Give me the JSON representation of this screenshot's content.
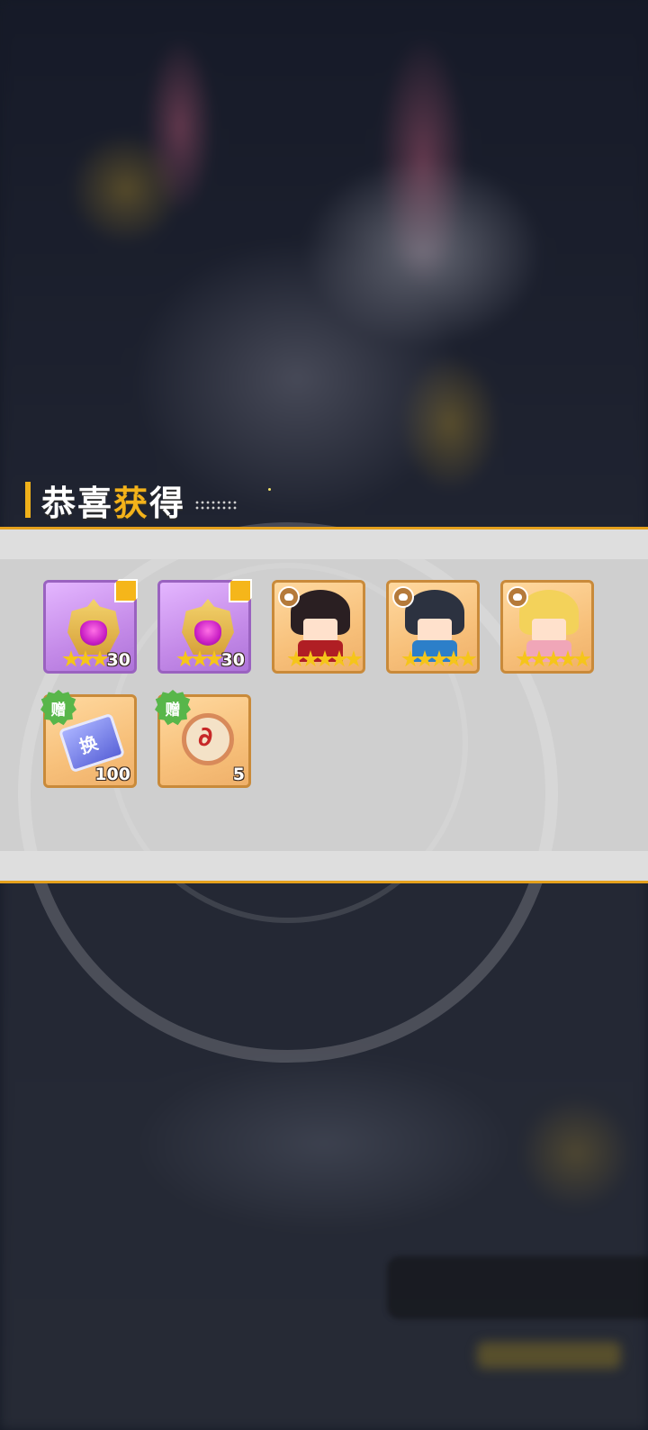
{
  "title": {
    "part1": "恭喜",
    "highlight": "获",
    "part2": "得"
  },
  "rewards": [
    {
      "name": "purple-helmet",
      "quantity": "30",
      "stars": 3,
      "frame": "purple",
      "badge": "corner-tag"
    },
    {
      "name": "purple-helmet",
      "quantity": "30",
      "stars": 3,
      "frame": "purple",
      "badge": "corner-tag"
    },
    {
      "name": "hero-dark-hair-red-coat",
      "quantity": "",
      "stars": 5,
      "frame": "orange",
      "badge": "lotus"
    },
    {
      "name": "hero-dark-hair-blue-coat",
      "quantity": "",
      "stars": 5,
      "frame": "orange",
      "badge": "lotus"
    },
    {
      "name": "hero-blonde-fox-girl",
      "quantity": "",
      "stars": 5,
      "frame": "orange",
      "badge": "lotus"
    },
    {
      "name": "exchange-ticket",
      "quantity": "100",
      "stars": 0,
      "frame": "orange",
      "badge": "gift",
      "badge_label": "赠"
    },
    {
      "name": "dragon-coin",
      "quantity": "5",
      "stars": 0,
      "frame": "orange",
      "badge": "gift",
      "badge_label": "赠"
    }
  ],
  "colors": {
    "accent": "#f3b21a",
    "panel_border": "#e5a11d",
    "gift_badge": "#58b64a"
  }
}
